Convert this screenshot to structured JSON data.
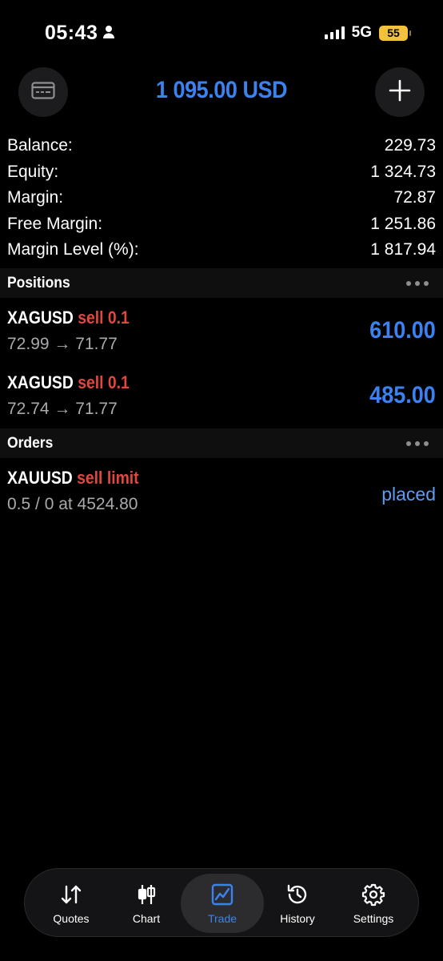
{
  "status_bar": {
    "time": "05:43",
    "network": "5G",
    "battery": "55"
  },
  "header": {
    "title": "1 095.00 USD",
    "left_icon": "card-icon",
    "right_icon": "plus-icon"
  },
  "summary": [
    {
      "label": "Balance:",
      "value": "229.73"
    },
    {
      "label": "Equity:",
      "value": "1 324.73"
    },
    {
      "label": "Margin:",
      "value": "72.87"
    },
    {
      "label": "Free Margin:",
      "value": "1 251.86"
    },
    {
      "label": "Margin Level (%):",
      "value": "1 817.94"
    }
  ],
  "positions": {
    "title": "Positions",
    "items": [
      {
        "symbol": "XAGUSD",
        "side": "sell 0.1",
        "prices": "72.99 → 71.77",
        "profit": "610.00"
      },
      {
        "symbol": "XAGUSD",
        "side": "sell 0.1",
        "prices": "72.74 → 71.77",
        "profit": "485.00"
      }
    ]
  },
  "orders": {
    "title": "Orders",
    "items": [
      {
        "symbol": "XAUUSD",
        "side": "sell limit",
        "details": "0.5 / 0 at 4524.80",
        "state": "placed"
      }
    ]
  },
  "tabs": [
    {
      "label": "Quotes",
      "icon": "quotes-arrows-icon"
    },
    {
      "label": "Chart",
      "icon": "candlestick-icon"
    },
    {
      "label": "Trade",
      "icon": "trade-chart-icon",
      "active": true
    },
    {
      "label": "History",
      "icon": "history-clock-icon"
    },
    {
      "label": "Settings",
      "icon": "gear-icon"
    }
  ],
  "colors": {
    "accent": "#3b82f0",
    "sell": "#e0473d",
    "battery": "#f3c23c"
  }
}
